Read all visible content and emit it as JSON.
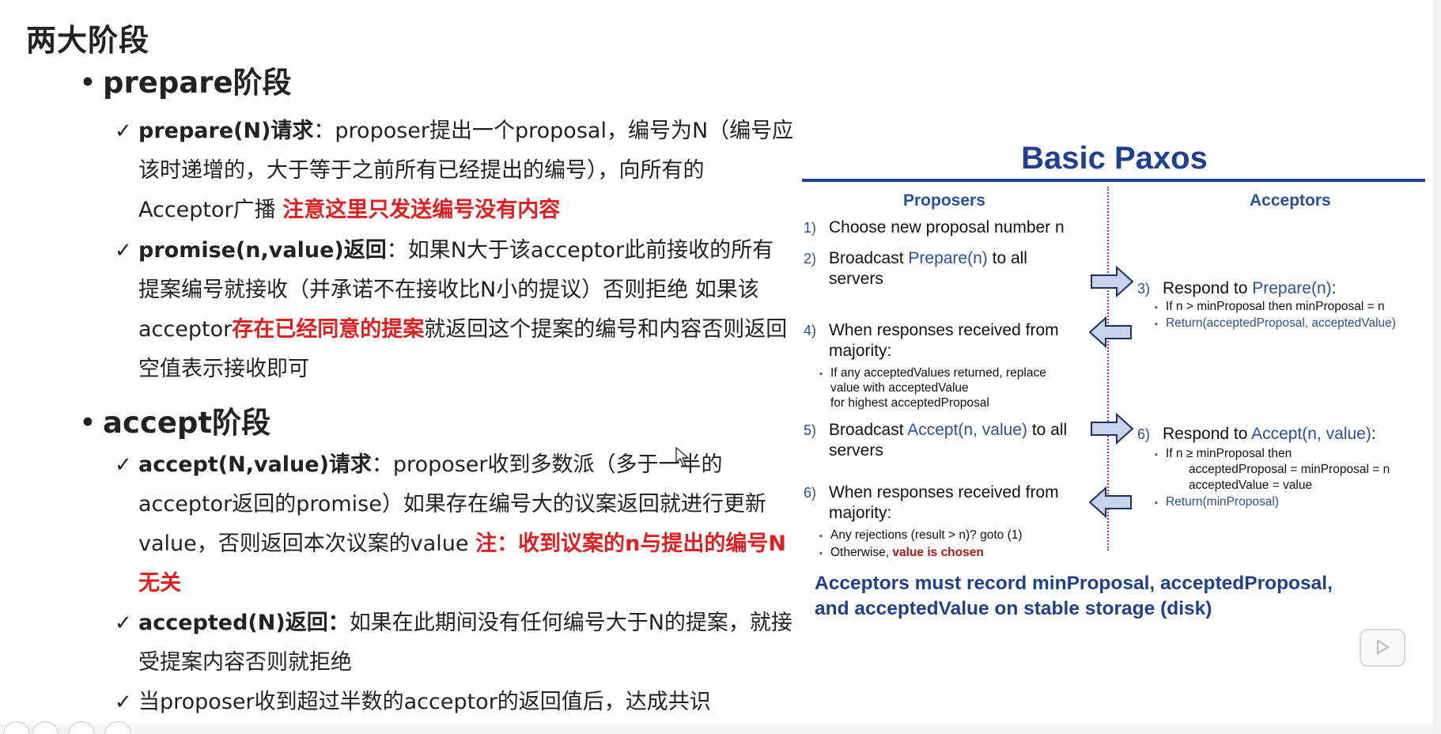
{
  "slide": {
    "title": "两大阶段",
    "prepare_heading": "prepare阶段",
    "accept_heading": "accept阶段",
    "bullet_symbol": "•",
    "check_symbol": "✓",
    "prepare_items": [
      {
        "term": "prepare(N)请求",
        "text": "：proposer提出一个proposal，编号为N（编号应该时递增的，大于等于之前所有已经提出的编号），向所有的Acceptor广播 ",
        "highlight": "注意这里只发送编号没有内容",
        "after": ""
      },
      {
        "term": "promise(n,value)返回",
        "text": "：如果N大于该acceptor此前接收的所有提案编号就接收（并承诺不在接收比N小的提议）否则拒绝 如果该acceptor",
        "highlight": "存在已经同意的提案",
        "after": "就返回这个提案的编号和内容否则返回空值表示接收即可"
      }
    ],
    "accept_items": [
      {
        "term": "accept(N,value)请求",
        "text": "：proposer收到多数派（多于一半的acceptor返回的promise）如果存在编号大的议案返回就进行更新value，否则返回本次议案的value ",
        "highlight": "注：收到议案的n与提出的编号N无关",
        "after": ""
      },
      {
        "term": "accepted(N)返回：",
        "text": "如果在此期间没有任何编号大于N的提案，就接受提案内容否则就拒绝",
        "highlight": "",
        "after": ""
      },
      {
        "term": "",
        "text": "当proposer收到超过半数的acceptor的返回值后，达成共识",
        "highlight": "",
        "after": ""
      }
    ]
  },
  "diagram": {
    "title": "Basic Paxos",
    "proposers_label": "Proposers",
    "acceptors_label": "Acceptors",
    "p1_num": "1)",
    "p1_text": "Choose new proposal number n",
    "p2_num": "2)",
    "p2_pre": "Broadcast ",
    "p2_call": "Prepare(n)",
    "p2_post": " to all",
    "p2_line2": "servers",
    "a3_num": "3)",
    "a3_pre": "Respond to ",
    "a3_call": "Prepare(n)",
    "a3_post": ":",
    "a3_sub1": "If n > minProposal then minProposal = n",
    "a3_sub2": "Return(acceptedProposal, acceptedValue)",
    "p4_num": "4)",
    "p4_text": "When responses received from",
    "p4_line2": "majority:",
    "p4_sub1": "If any acceptedValues returned, replace",
    "p4_sub2": "value with acceptedValue",
    "p4_sub3": "for highest acceptedProposal",
    "p5_num": "5)",
    "p5_pre": "Broadcast ",
    "p5_call": "Accept(n, value)",
    "p5_post": " to all",
    "p5_line2": "servers",
    "a6_num": "6)",
    "a6_pre": "Respond to ",
    "a6_call": "Accept(n, value)",
    "a6_post": ":",
    "a6_sub1": "If n ≥ minProposal then",
    "a6_sub2": "acceptedProposal = minProposal = n",
    "a6_sub3": "acceptedValue = value",
    "a6_sub4": "Return(minProposal)",
    "p6_num": "6)",
    "p6_text": "When responses received from",
    "p6_line2": "majority:",
    "p6_sub1": "Any rejections (result > n)?  goto (1)",
    "p6_sub2_pre": "Otherwise, ",
    "p6_sub2_hl": "value is chosen",
    "footer_line1": "Acceptors must record minProposal, acceptedProposal,",
    "footer_line2": "and acceptedValue on stable storage (disk)",
    "square_bullet": "▪",
    "colors": {
      "title_blue": "#1f3f8f",
      "text_blue": "#2a4f9f",
      "arrow_fill": "#c7d3ec",
      "highlight_red": "#b01818"
    }
  },
  "colors": {
    "emphasis_red": "#e02020"
  },
  "icons": {
    "play": "play-icon",
    "cursor": "mouse-cursor-icon"
  }
}
